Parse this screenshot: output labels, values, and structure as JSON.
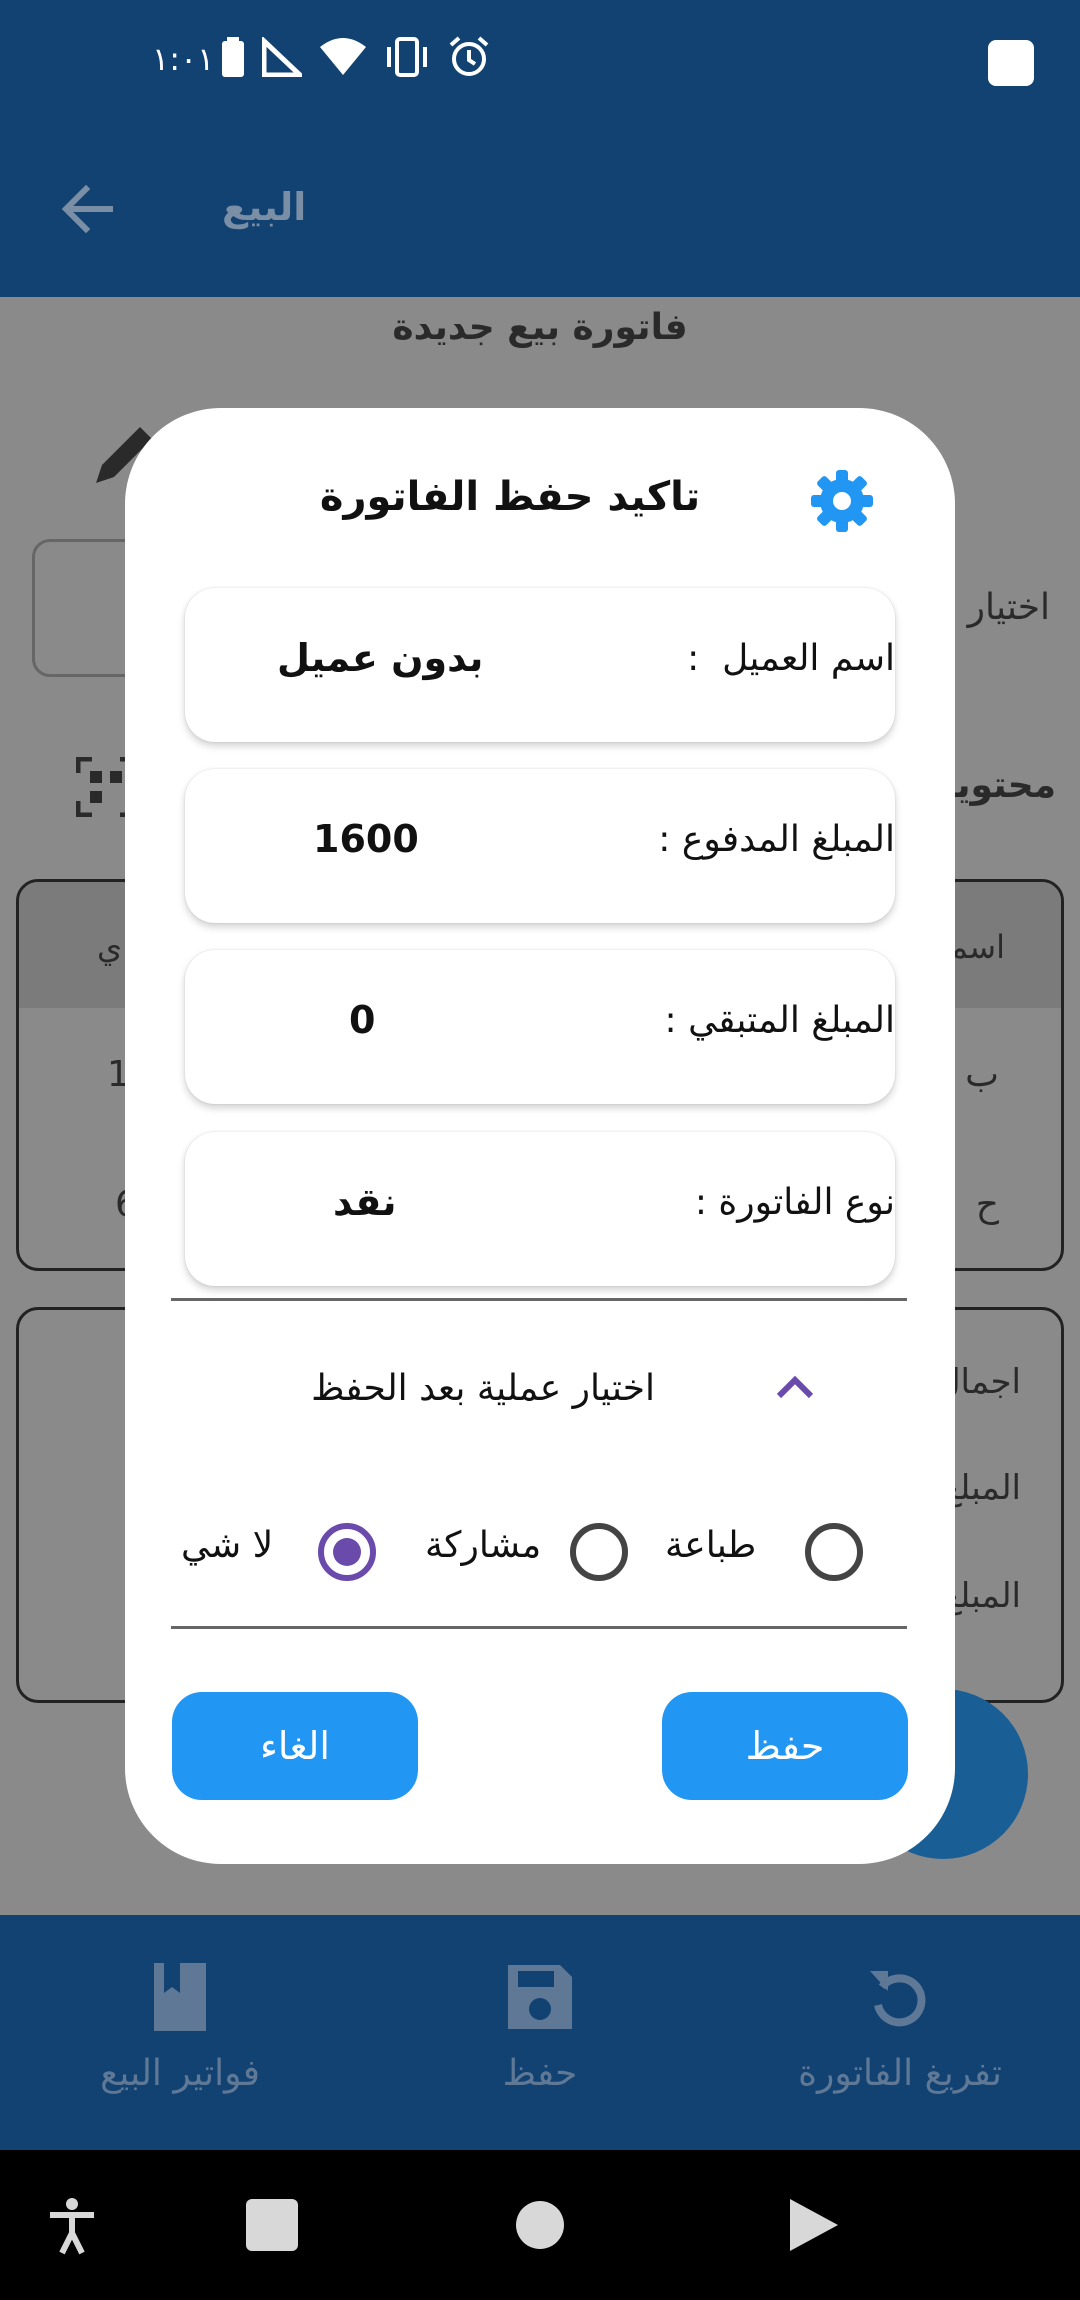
{
  "status_bar": {
    "time": "١:٠١"
  },
  "app_bar": {
    "title": "البيع"
  },
  "background": {
    "invoice_title": "فاتورة بيع جديدة",
    "select_label": "اختيار",
    "contents_label": "محتويا",
    "table_header_right": "اسم",
    "table_header_left": "ي",
    "cell_left_1": "1",
    "cell_left_2": "6",
    "cell_right_1": "ب",
    "cell_right_2": "ح",
    "totals_1": "اجمال",
    "totals_2": "المبلغ",
    "totals_3": "المبلغ"
  },
  "dialog": {
    "title": "تاكيد حفظ الفاتورة",
    "rows": [
      {
        "label": "اسم العميل  :",
        "value": "بدون عميل"
      },
      {
        "label": "المبلغ المدفوع :",
        "value": "1600"
      },
      {
        "label": "المبلغ المتبقي :",
        "value": "0"
      },
      {
        "label": "نوع الفاتورة :",
        "value": "نقد"
      }
    ],
    "expander_title": "اختيار عملية بعد الحفظ",
    "options": [
      {
        "label": "طباعة",
        "selected": false
      },
      {
        "label": "مشاركة",
        "selected": false
      },
      {
        "label": "لا شي",
        "selected": true
      }
    ],
    "save_button": "حفظ",
    "cancel_button": "الغاء"
  },
  "bottom_nav": [
    {
      "label": "فواتير البيع",
      "icon": "book-icon"
    },
    {
      "label": "حفظ",
      "icon": "save-icon"
    },
    {
      "label": "تفريغ الفاتورة",
      "icon": "refresh-icon"
    }
  ],
  "colors": {
    "primary": "#114272",
    "accent_button": "#2196f3",
    "radio_selected": "#6a4aab",
    "scrim": "#808080"
  }
}
